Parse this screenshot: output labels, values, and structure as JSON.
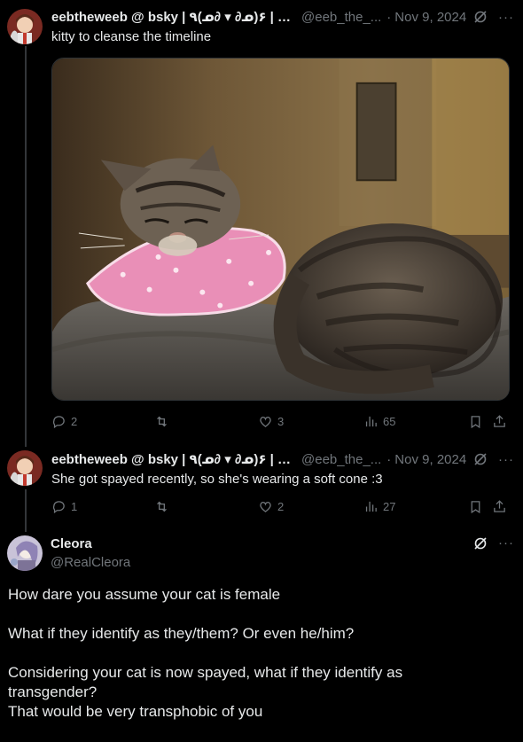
{
  "post1": {
    "author_name": "eebtheweeb @ bsky | ٩(ᓄ∂ ▾ ∂ᓄ)۶ | 18...",
    "author_handle": "@eeb_the_...",
    "separator": "·",
    "date": "Nov 9, 2024",
    "text": "kitty to cleanse the timeline",
    "photo_icon": "cat-photo",
    "stats": {
      "replies": "2",
      "reposts": "",
      "likes": "3",
      "views": "65"
    }
  },
  "post2": {
    "author_name": "eebtheweeb @ bsky | ٩(ᓄ∂ ▾ ∂ᓄ)۶ | 18...",
    "author_handle": "@eeb_the_...",
    "separator": "·",
    "date": "Nov 9, 2024",
    "text": "She got spayed recently, so she's wearing a soft cone :3",
    "stats": {
      "replies": "1",
      "reposts": "",
      "likes": "2",
      "views": "27"
    }
  },
  "post3": {
    "author_name": "Cleora",
    "author_handle": "@RealCleora",
    "lines": [
      "How dare you assume your cat is female",
      "What if they identify as they/them? Or even he/him?",
      "Considering your cat is now spayed, what if they identify as",
      "transgender?",
      "That would be very transphobic of you"
    ]
  },
  "icons": {
    "reply": "reply-icon",
    "repost": "repost-icon",
    "like": "heart-icon",
    "views": "views-icon",
    "bookmark": "bookmark-icon",
    "share": "share-icon",
    "grok": "grok-icon",
    "more": "more-icon"
  },
  "colors": {
    "background": "#000000",
    "text": "#e7e9ea",
    "muted": "#71767b",
    "thread_line": "#333639"
  }
}
